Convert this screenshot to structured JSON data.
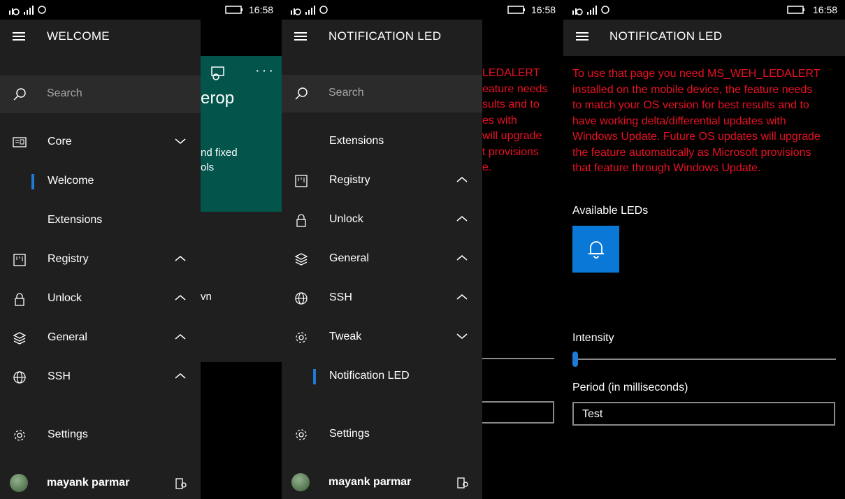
{
  "status": {
    "time": "16:58"
  },
  "panel1": {
    "title": "WELCOME",
    "search_placeholder": "Search",
    "nav": [
      {
        "label": "Core",
        "chevron": "down",
        "icon": "dashboard-icon"
      },
      {
        "label": "Welcome",
        "selected": true
      },
      {
        "label": "Extensions"
      },
      {
        "label": "Registry",
        "chevron": "up",
        "icon": "registry-icon"
      },
      {
        "label": "Unlock",
        "chevron": "up",
        "icon": "lock-icon"
      },
      {
        "label": "General",
        "chevron": "up",
        "icon": "stack-icon"
      },
      {
        "label": "SSH",
        "chevron": "up",
        "icon": "globe-icon"
      }
    ],
    "settings_label": "Settings",
    "user_name": "mayank parmar",
    "bg": {
      "tile_title": "erop",
      "tile_text_1": "nd fixed",
      "tile_text_2": "ols",
      "dark_text": "vn"
    }
  },
  "panel2": {
    "title": "NOTIFICATION LED",
    "search_placeholder": "Search",
    "nav": [
      {
        "label": "Extensions"
      },
      {
        "label": "Registry",
        "chevron": "up",
        "icon": "registry-icon"
      },
      {
        "label": "Unlock",
        "chevron": "up",
        "icon": "lock-icon"
      },
      {
        "label": "General",
        "chevron": "up",
        "icon": "stack-icon"
      },
      {
        "label": "SSH",
        "chevron": "up",
        "icon": "globe-icon"
      },
      {
        "label": "Tweak",
        "chevron": "down",
        "icon": "gear-icon"
      },
      {
        "label": "Notification LED",
        "selected": true
      }
    ],
    "settings_label": "Settings",
    "user_name": "mayank parmar",
    "behind_lines": [
      "LEDALERT",
      "eature needs",
      "sults and to",
      "es with",
      " will upgrade",
      "t provisions",
      "e."
    ]
  },
  "panel3": {
    "title": "NOTIFICATION LED",
    "message_lines": [
      "To use that page you need MS_WEH_LEDALERT",
      "installed on the mobile device, the feature needs",
      "to match your OS version for best results and to",
      "have working delta/differential updates with",
      "Windows Update. Future OS updates will upgrade",
      "the feature automatically as Microsoft provisions",
      "that feature through Windows Update."
    ],
    "available_leds_label": "Available LEDs",
    "intensity_label": "Intensity",
    "intensity_value": 0,
    "period_label": "Period (in milliseconds)",
    "period_value": "Test"
  },
  "colors": {
    "accent": "#0a78d6",
    "error": "#e81123",
    "teal_tile": "#03544b",
    "pane": "#1f1f1f"
  }
}
